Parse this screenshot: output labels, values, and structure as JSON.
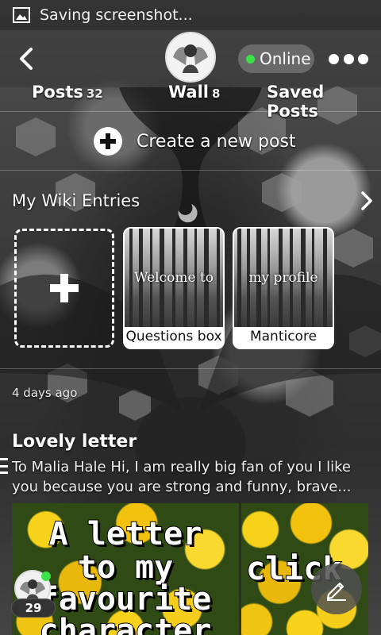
{
  "status_bar": {
    "text": "Saving screenshot...",
    "icon": "image-icon"
  },
  "header": {
    "back_icon": "chevron-left-icon",
    "avatar_icon": "profile-avatar",
    "status_label": "Online",
    "status_color": "#3ee04a",
    "more_icon": "more-dots-icon"
  },
  "tabs": [
    {
      "label": "Posts",
      "count": "32"
    },
    {
      "label": "Wall",
      "count": "8"
    },
    {
      "label": "Saved Posts",
      "count": ""
    }
  ],
  "create_post": {
    "label": "Create a new post",
    "icon": "plus-circle-icon"
  },
  "wiki": {
    "title": "My Wiki Entries",
    "arrow_icon": "chevron-right-icon",
    "add_icon": "plus-icon",
    "entries": [
      {
        "thumb_text": "Welcome to",
        "label": "Questions box"
      },
      {
        "thumb_text": "my profile",
        "label": "Manticore"
      }
    ]
  },
  "post": {
    "time": "4 days ago",
    "title": "Lovely letter",
    "excerpt": "To Malia Hale Hi, I am really big fan of you I like you because you are strong and funny, brave...",
    "image_left_lines": [
      "A letter",
      "to my",
      "favourite",
      "character"
    ],
    "image_right_text": "click"
  },
  "floating": {
    "badge_count": "29",
    "fab_icon": "pencil-icon"
  }
}
